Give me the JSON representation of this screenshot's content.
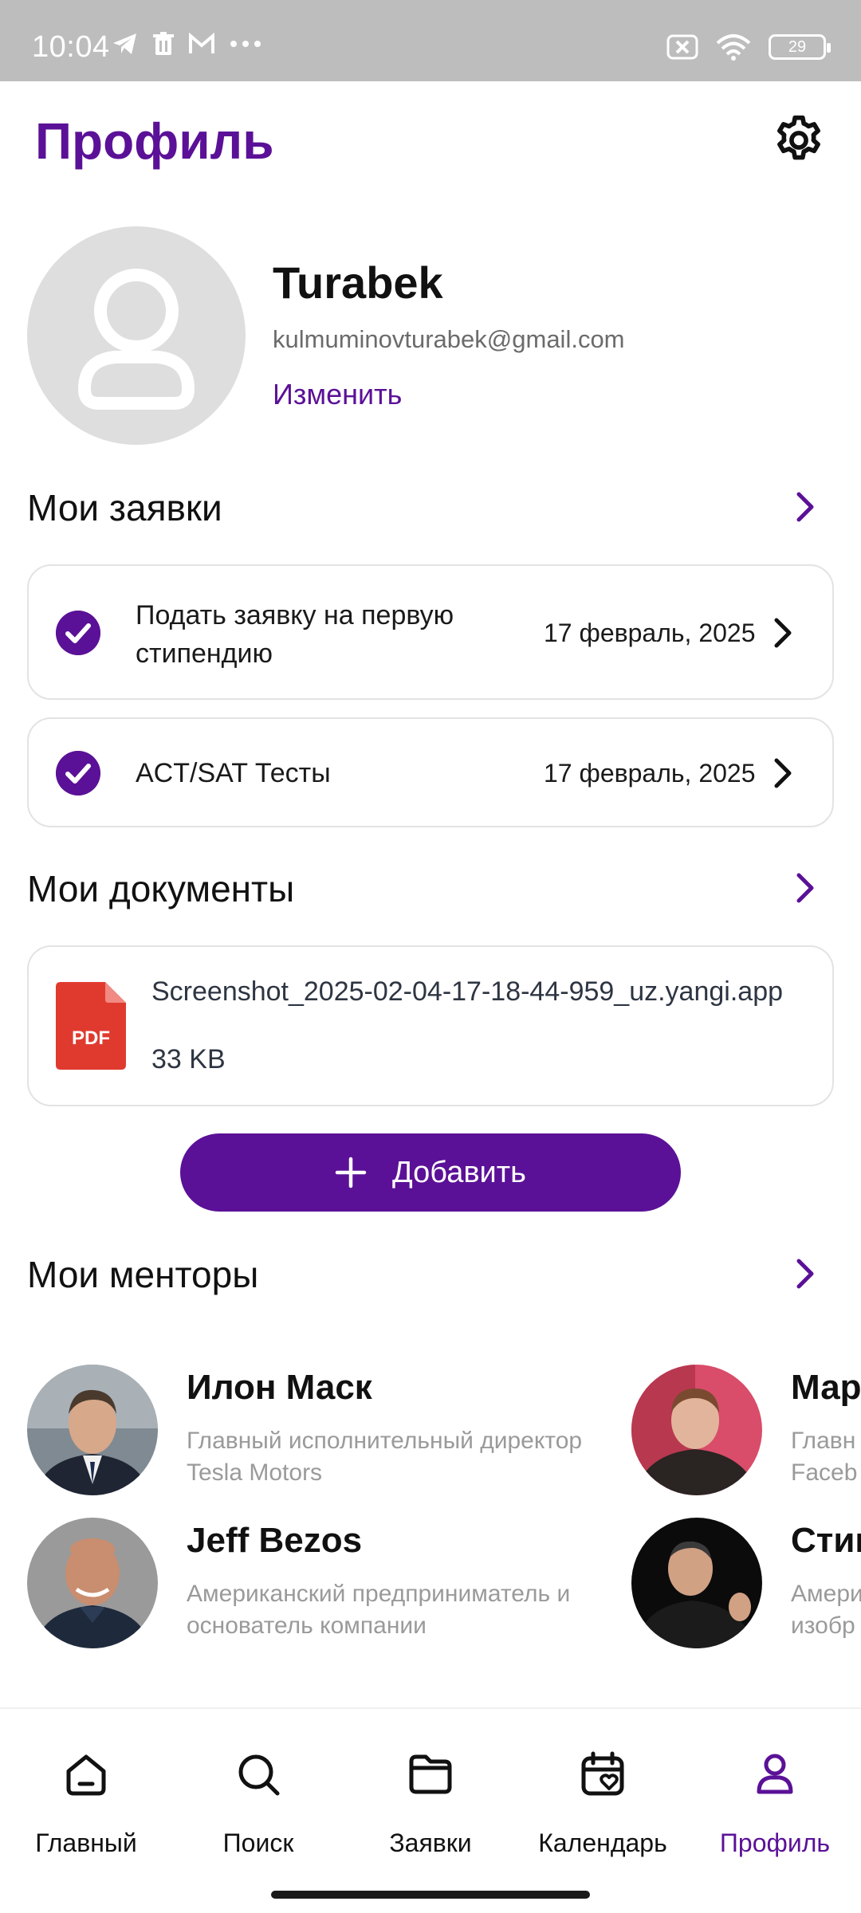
{
  "status_bar": {
    "time": "10:04",
    "battery": "29",
    "icons_left": [
      "telegram-icon",
      "trash-icon",
      "gmail-icon",
      "more-dots-icon"
    ],
    "icons_right": [
      "sim-off-icon",
      "wifi-icon",
      "battery-icon"
    ]
  },
  "header": {
    "title": "Профиль",
    "settings_icon": "gear-icon"
  },
  "profile": {
    "name": "Turabek",
    "email": "kulmuminovturabek@gmail.com",
    "edit_label": "Изменить"
  },
  "applications": {
    "title": "Мои заявки",
    "items": [
      {
        "title_line1": "Подать заявку на первую",
        "title_line2": "стипендию",
        "date": "17 февраль, 2025",
        "status_icon": "check-circle-icon"
      },
      {
        "title_line1": "ACT/SAT Тесты",
        "title_line2": "",
        "date": "17 февраль, 2025",
        "status_icon": "check-circle-icon"
      }
    ]
  },
  "documents": {
    "title": "Мои документы",
    "items": [
      {
        "type_label": "PDF",
        "name": "Screenshot_2025-02-04-17-18-44-959_uz.yangi.app",
        "size": "33 KB"
      }
    ],
    "add_label": "Добавить"
  },
  "mentors": {
    "title": "Мои менторы",
    "items": [
      {
        "name": "Илон Маск",
        "role": "Главный исполнительный директор Tesla Motors"
      },
      {
        "name": "Мар",
        "role": "Главн Faceb"
      },
      {
        "name": "Jeff Bezos",
        "role": "Американский предприниматель и основатель компании"
      },
      {
        "name": "Стив",
        "role": "Амери изобр"
      }
    ]
  },
  "bottom_nav": {
    "items": [
      {
        "label": "Главный",
        "icon": "home-icon"
      },
      {
        "label": "Поиск",
        "icon": "search-icon"
      },
      {
        "label": "Заявки",
        "icon": "folder-icon"
      },
      {
        "label": "Календарь",
        "icon": "calendar-heart-icon"
      },
      {
        "label": "Профиль",
        "icon": "user-icon"
      }
    ],
    "active_index": 4
  },
  "colors": {
    "accent": "#5b1197",
    "status_bar": "#bdbdbd",
    "pdf_red": "#e03a2f"
  }
}
